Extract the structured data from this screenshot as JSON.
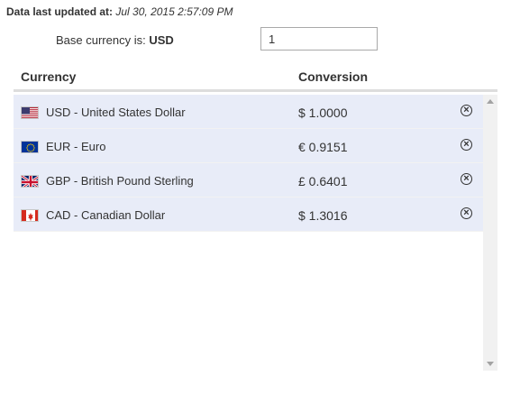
{
  "header": {
    "updated_label": "Data last updated at:",
    "updated_value": "Jul 30, 2015 2:57:09 PM"
  },
  "base": {
    "label": "Base currency is:",
    "code": "USD",
    "amount": "1"
  },
  "table": {
    "columns": [
      "Currency",
      "Conversion"
    ],
    "rows": [
      {
        "flag": "us-flag-icon",
        "name": "USD - United States Dollar",
        "conversion": "$ 1.0000"
      },
      {
        "flag": "eu-flag-icon",
        "name": "EUR - Euro",
        "conversion": "€ 0.9151"
      },
      {
        "flag": "gb-flag-icon",
        "name": "GBP - British Pound Sterling",
        "conversion": "£ 0.6401"
      },
      {
        "flag": "ca-flag-icon",
        "name": "CAD - Canadian Dollar",
        "conversion": "$ 1.3016"
      }
    ]
  },
  "icons": {
    "remove": "remove-circle-icon"
  },
  "colors": {
    "row_bg": "#e8ecf8",
    "header_rule": "#dddddd"
  }
}
